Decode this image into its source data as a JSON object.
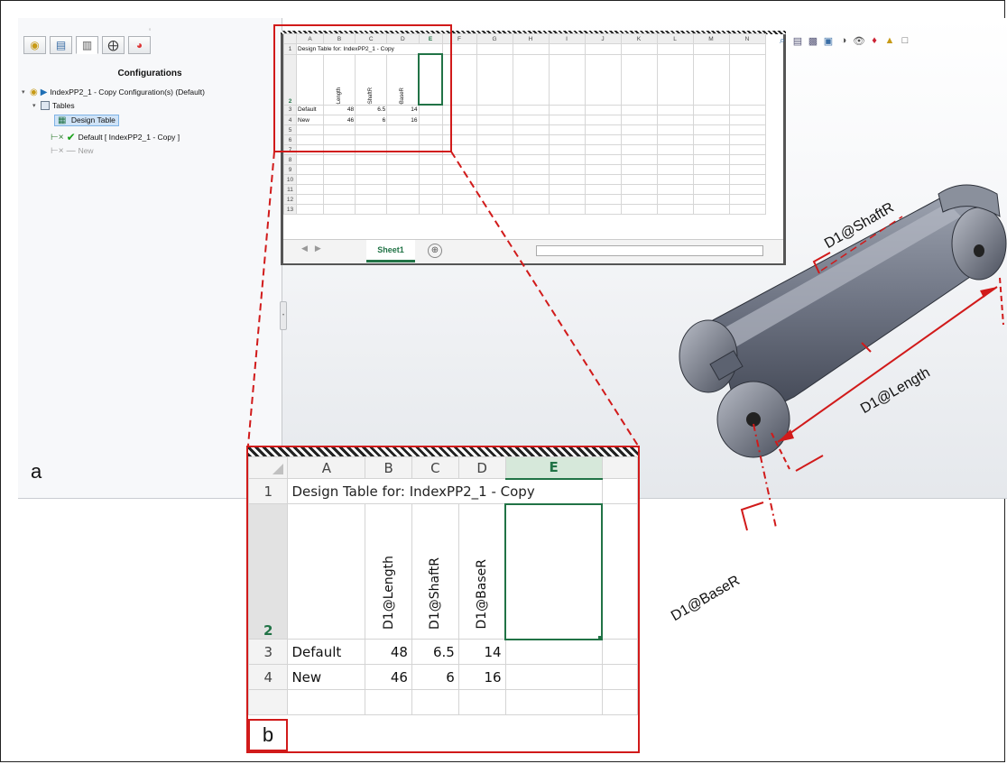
{
  "panel_labels": {
    "a": "a",
    "b": "b"
  },
  "feature_manager": {
    "grip": "◦",
    "tab_icons": [
      "part-icon",
      "property-icon",
      "configuration-icon",
      "dimxpert-icon",
      "display-icon"
    ],
    "title": "Configurations",
    "tree": {
      "root": "IndexPP2_1 - Copy Configuration(s)  (Default)",
      "tables": "Tables",
      "design_table": "Design Table",
      "config_default": "Default [ IndexPP2_1 - Copy ]",
      "config_new": "New"
    }
  },
  "mini_excel": {
    "columns": [
      "A",
      "B",
      "C",
      "D",
      "E",
      "F",
      "G",
      "H",
      "I",
      "J",
      "K",
      "L",
      "M",
      "N"
    ],
    "row_numbers": [
      "1",
      "2",
      "3",
      "4",
      "5",
      "6",
      "7",
      "8",
      "9",
      "10",
      "11",
      "12",
      "13"
    ],
    "sheet_tab": "Sheet1",
    "add_sheet": "⊕"
  },
  "design_table": {
    "columns": [
      "A",
      "B",
      "C",
      "D",
      "E"
    ],
    "title": "Design Table for: IndexPP2_1 - Copy",
    "parameters": [
      "D1@Length",
      "D1@ShaftR",
      "D1@BaseR"
    ],
    "rows": [
      {
        "row": "3",
        "name": "Default",
        "values": [
          "48",
          "6.5",
          "14"
        ]
      },
      {
        "row": "4",
        "name": "New",
        "values": [
          "46",
          "6",
          "16"
        ]
      }
    ],
    "selected_column": "E",
    "selected_row": "2"
  },
  "dimensions": {
    "shaft_r": "D1@ShaftR",
    "length": "D1@Length",
    "base_r": "D1@BaseR"
  },
  "colors": {
    "highlight_red": "#d11a1a",
    "excel_green": "#217346"
  }
}
